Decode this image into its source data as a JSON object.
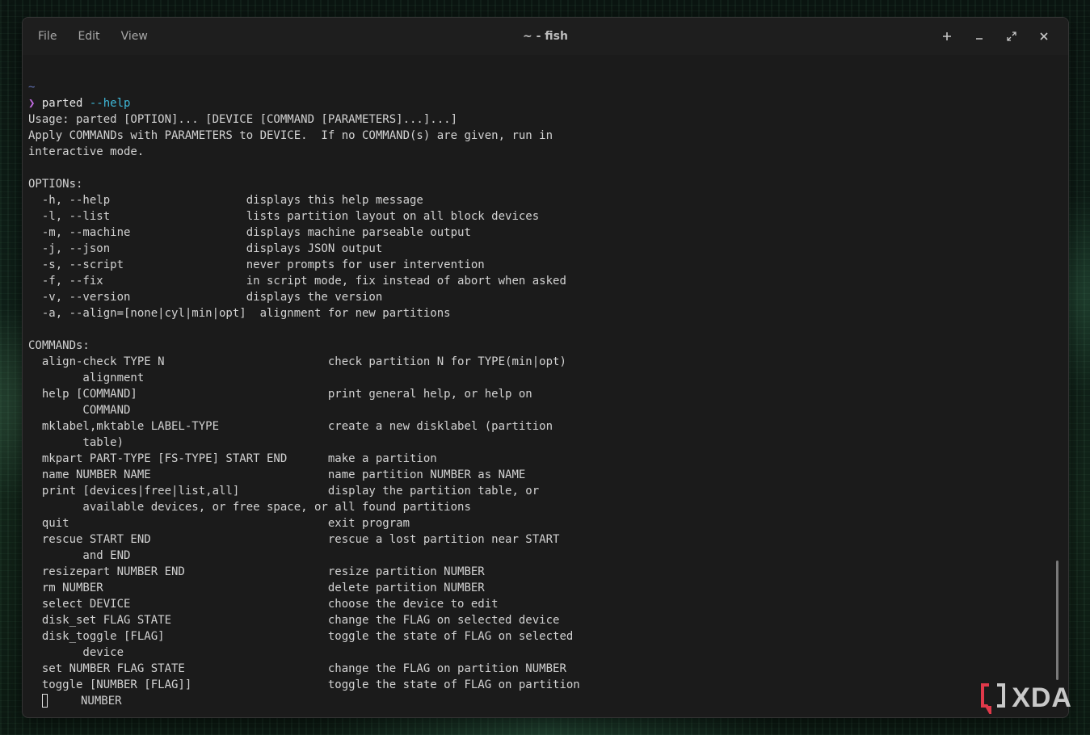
{
  "menu": {
    "file": "File",
    "edit": "Edit",
    "view": "View"
  },
  "window": {
    "title": "~ - fish"
  },
  "controls": [
    "new-tab",
    "minimize",
    "maximize",
    "close"
  ],
  "terminal": {
    "cwd_line": "~",
    "prompt_symbol": "❯",
    "command": "parted",
    "command_arg": " --help",
    "output_lines": [
      "Usage: parted [OPTION]... [DEVICE [COMMAND [PARAMETERS]...]...]",
      "Apply COMMANDs with PARAMETERS to DEVICE.  If no COMMAND(s) are given, run in",
      "interactive mode.",
      "",
      "OPTIONs:",
      "  -h, --help                    displays this help message",
      "  -l, --list                    lists partition layout on all block devices",
      "  -m, --machine                 displays machine parseable output",
      "  -j, --json                    displays JSON output",
      "  -s, --script                  never prompts for user intervention",
      "  -f, --fix                     in script mode, fix instead of abort when asked",
      "  -v, --version                 displays the version",
      "  -a, --align=[none|cyl|min|opt]  alignment for new partitions",
      "",
      "COMMANDs:",
      "  align-check TYPE N                        check partition N for TYPE(min|opt)",
      "        alignment",
      "  help [COMMAND]                            print general help, or help on",
      "        COMMAND",
      "  mklabel,mktable LABEL-TYPE                create a new disklabel (partition",
      "        table)",
      "  mkpart PART-TYPE [FS-TYPE] START END      make a partition",
      "  name NUMBER NAME                          name partition NUMBER as NAME",
      "  print [devices|free|list,all]             display the partition table, or",
      "        available devices, or free space, or all found partitions",
      "  quit                                      exit program",
      "  rescue START END                          rescue a lost partition near START",
      "        and END",
      "  resizepart NUMBER END                     resize partition NUMBER",
      "  rm NUMBER                                 delete partition NUMBER",
      "  select DEVICE                             choose the device to edit",
      "  disk_set FLAG STATE                       change the FLAG on selected device",
      "  disk_toggle [FLAG]                        toggle the state of FLAG on selected",
      "        device",
      "  set NUMBER FLAG STATE                     change the FLAG on partition NUMBER",
      "  toggle [NUMBER [FLAG]]                    toggle the state of FLAG on partition"
    ],
    "last_line_text": "NUMBER"
  },
  "watermark": {
    "text": "XDA"
  },
  "colors": {
    "prompt": "#c06adf",
    "arg": "#3fb8d8",
    "tilde": "#5f6fb0",
    "watermark_accent": "#e0394a"
  }
}
